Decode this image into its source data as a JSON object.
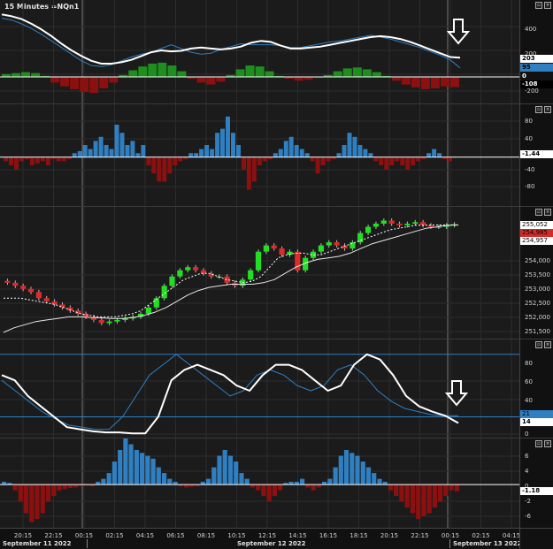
{
  "header": {
    "title": "15 Minutes =NQn1"
  },
  "colors": {
    "pos_green": "#1e8f1e",
    "neg_red": "#8b1010",
    "blue": "#2f7fc1",
    "white": "#ffffff",
    "candle_up": "#21e021",
    "candle_down": "#e02a2a"
  },
  "icons": [
    "restore-icon",
    "close-icon"
  ],
  "x_axis": {
    "ticks": [
      "20:15",
      "22:15",
      "00:15",
      "02:15",
      "04:15",
      "06:15",
      "08:15",
      "10:15",
      "12:15",
      "14:15",
      "16:15",
      "18:15",
      "20:15",
      "22:15",
      "00:15",
      "02:15",
      "04:15"
    ],
    "dates": [
      "September 11 2022",
      "September 12 2022",
      "September 13 2022"
    ]
  },
  "panels": {
    "p1": {
      "ticks": [
        "400",
        "200",
        "0",
        "-200"
      ],
      "tags": [
        "203",
        "95",
        "0",
        "-108"
      ]
    },
    "p2": {
      "ticks": [
        "80",
        "40",
        "0",
        "-40",
        "-80"
      ],
      "tags": [
        "-1.44"
      ]
    },
    "p3": {
      "ticks": [
        "254,000",
        "253,500",
        "253,000",
        "252,500",
        "252,000",
        "251,500"
      ],
      "tags": [
        "255,052",
        "254,985",
        "254,957"
      ]
    },
    "p4": {
      "ticks": [
        "80",
        "60",
        "40",
        "20",
        "0"
      ],
      "tags": [
        "21",
        "14"
      ]
    },
    "p5": {
      "ticks": [
        "6",
        "4",
        "2",
        "0",
        "-2",
        "-4",
        "-6"
      ],
      "tags": [
        "-1.18"
      ]
    }
  },
  "chart_data": [
    {
      "type": "line",
      "name": "MACD panel",
      "ylim": [
        -280,
        700
      ],
      "series": [
        {
          "name": "line_white",
          "values": [
            660,
            640,
            610,
            560,
            500,
            430,
            350,
            280,
            220,
            170,
            140,
            140,
            155,
            180,
            220,
            260,
            280,
            270,
            275,
            300,
            310,
            300,
            290,
            300,
            320,
            360,
            380,
            370,
            330,
            300,
            300,
            310,
            320,
            340,
            360,
            380,
            400,
            420,
            430,
            420,
            400,
            370,
            330,
            290,
            250,
            210,
            203
          ]
        },
        {
          "name": "line_blue",
          "values": [
            620,
            600,
            560,
            510,
            450,
            380,
            310,
            240,
            170,
            120,
            110,
            130,
            170,
            210,
            240,
            260,
            300,
            340,
            300,
            260,
            240,
            250,
            290,
            320,
            350,
            340,
            340,
            340,
            330,
            310,
            310,
            330,
            350,
            370,
            380,
            400,
            420,
            440,
            420,
            400,
            370,
            340,
            310,
            270,
            230,
            180,
            95
          ]
        },
        {
          "name": "histogram",
          "values": [
            30,
            40,
            50,
            40,
            10,
            -60,
            -100,
            -130,
            -160,
            -170,
            -120,
            -60,
            20,
            70,
            110,
            140,
            150,
            120,
            60,
            -20,
            -60,
            -80,
            -50,
            20,
            80,
            120,
            110,
            60,
            10,
            -20,
            -40,
            -30,
            -10,
            20,
            60,
            90,
            100,
            80,
            50,
            10,
            -40,
            -80,
            -110,
            -130,
            -120,
            -100,
            -108
          ]
        }
      ]
    },
    {
      "type": "bar",
      "name": "Panel 2 histogram",
      "ylim": [
        -120,
        130
      ],
      "values": [
        -10,
        -20,
        -30,
        -10,
        -5,
        -20,
        -15,
        -10,
        -20,
        -5,
        -10,
        -10,
        -5,
        10,
        15,
        30,
        20,
        40,
        50,
        30,
        20,
        80,
        60,
        30,
        40,
        10,
        30,
        -20,
        -40,
        -60,
        -60,
        -40,
        -20,
        -10,
        -5,
        10,
        10,
        20,
        30,
        20,
        60,
        70,
        100,
        60,
        30,
        -30,
        -80,
        -60,
        -20,
        -10,
        -5,
        10,
        20,
        40,
        50,
        30,
        20,
        10,
        -10,
        -40,
        -20,
        -10,
        -5,
        10,
        30,
        60,
        50,
        30,
        20,
        10,
        -10,
        -20,
        -30,
        -20,
        -10,
        -20,
        -30,
        -20,
        -10,
        -5,
        10,
        20,
        10,
        -5,
        -10,
        -1.44
      ]
    },
    {
      "type": "line",
      "name": "Price candles",
      "ylim": [
        251300,
        255400
      ],
      "series": [
        {
          "name": "close",
          "values": [
            253100,
            253000,
            252900,
            252800,
            252600,
            252500,
            252400,
            252300,
            252200,
            252100,
            252000,
            251900,
            251800,
            251850,
            251900,
            251950,
            252000,
            252100,
            252300,
            252600,
            253000,
            253300,
            253500,
            253600,
            253500,
            253400,
            253300,
            253300,
            253100,
            253000,
            253200,
            253500,
            254100,
            254300,
            254200,
            254000,
            254100,
            253500,
            253900,
            254100,
            254300,
            254400,
            254300,
            254200,
            254400,
            254700,
            254900,
            255000,
            255100,
            255000,
            254950,
            255000,
            255050,
            254950,
            254900,
            254900,
            254950,
            254985
          ]
        },
        {
          "name": "ma_fast",
          "values": [
            252600,
            252600,
            252600,
            252550,
            252500,
            252450,
            252400,
            252300,
            252200,
            252100,
            252050,
            252000,
            252000,
            252000,
            252050,
            252100,
            252200,
            252400,
            252600,
            252800,
            253000,
            253200,
            253300,
            253400,
            253400,
            253300,
            253200,
            253150,
            253100,
            253150,
            253300,
            253600,
            253900,
            254000,
            254050,
            254050,
            254000,
            254000,
            254100,
            254200,
            254300,
            254400,
            254500,
            254600,
            254700,
            254800,
            254850,
            254900,
            254950,
            254950,
            254960,
            254960,
            254957,
            254957
          ]
        },
        {
          "name": "ma_slow",
          "values": [
            251500,
            251650,
            251750,
            251850,
            251900,
            251950,
            252000,
            252000,
            251980,
            251970,
            251950,
            251950,
            251980,
            252050,
            252150,
            252300,
            252500,
            252700,
            252850,
            252950,
            253000,
            253050,
            253050,
            253050,
            253100,
            253200,
            253400,
            253600,
            253750,
            253850,
            253900,
            253950,
            254050,
            254200,
            254350,
            254450,
            254550,
            254650,
            254750,
            254850,
            254900,
            254950,
            254960
          ]
        }
      ]
    },
    {
      "type": "line",
      "name": "Stochastic",
      "ylim": [
        0,
        90
      ],
      "series": [
        {
          "name": "white",
          "values": [
            60,
            55,
            40,
            30,
            20,
            10,
            8,
            6,
            5,
            5,
            4,
            4,
            20,
            55,
            65,
            70,
            65,
            60,
            50,
            45,
            60,
            70,
            70,
            65,
            55,
            45,
            50,
            70,
            80,
            75,
            60,
            40,
            30,
            25,
            21,
            14
          ]
        },
        {
          "name": "blue",
          "values": [
            55,
            45,
            35,
            25,
            18,
            12,
            10,
            8,
            8,
            20,
            40,
            60,
            70,
            80,
            70,
            60,
            50,
            40,
            45,
            60,
            65,
            60,
            50,
            45,
            50,
            65,
            70,
            60,
            45,
            35,
            28,
            25,
            22,
            21,
            21
          ]
        }
      ],
      "reference_lines": [
        80,
        20
      ]
    },
    {
      "type": "bar",
      "name": "Panel 5 histogram",
      "ylim": [
        -7.5,
        8
      ],
      "values": [
        0.5,
        0.3,
        -1,
        -3,
        -5,
        -6.5,
        -6,
        -5,
        -3,
        -2,
        -1,
        -0.8,
        -0.6,
        -0.5,
        -0.3,
        -0.2,
        -0.3,
        0.5,
        1,
        2,
        4,
        6,
        8,
        7,
        6,
        5.5,
        5,
        4.5,
        3,
        2,
        1,
        0.5,
        -0.3,
        -0.5,
        -0.4,
        -0.3,
        0.5,
        1,
        3,
        5,
        6,
        5,
        4,
        2,
        1,
        -0.5,
        -1,
        -2,
        -3,
        -2,
        -1,
        0.3,
        0.5,
        0.5,
        1,
        -0.5,
        -1,
        -0.5,
        0.5,
        1,
        3,
        5,
        6,
        5.5,
        5,
        4,
        3,
        2,
        1,
        0.5,
        -1,
        -2,
        -3,
        -4,
        -5,
        -6,
        -5.5,
        -5,
        -4,
        -3,
        -2,
        -1,
        -1.18
      ]
    }
  ]
}
